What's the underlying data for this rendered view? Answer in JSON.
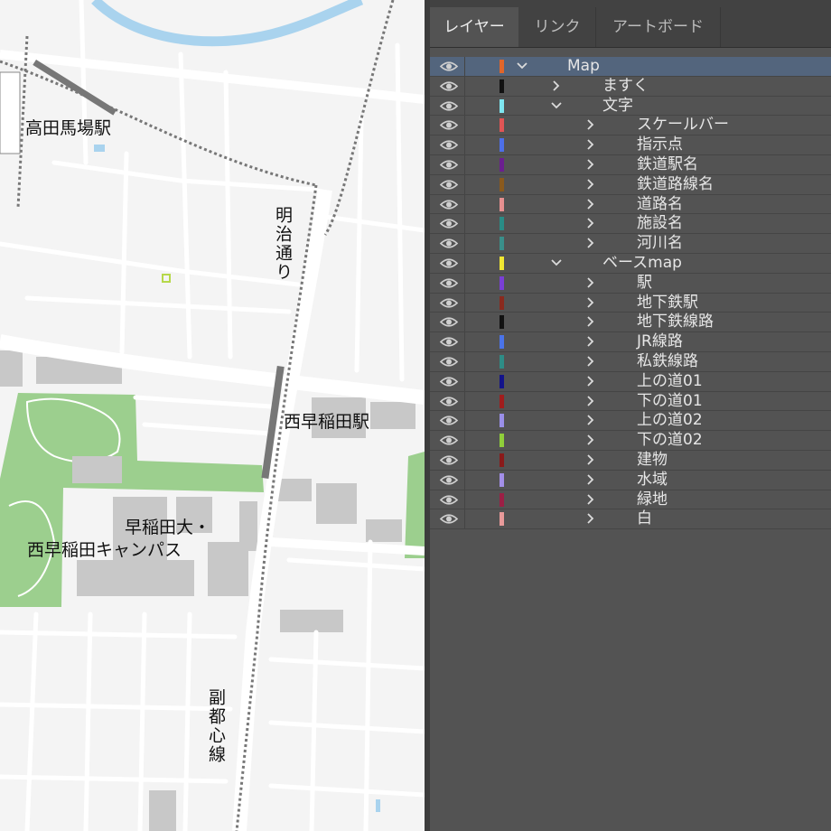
{
  "map": {
    "labels": {
      "takadanobaba": "高田馬場駅",
      "meiji_dori": "明治通り",
      "nishiwaseda_station": "西早稲田駅",
      "campus_line1": "早稲田大・",
      "campus_line2": "西早稲田キャンパス",
      "fukutoshin": "副都心線"
    },
    "colors": {
      "background": "#f4f4f4",
      "river": "#a9d3ee",
      "park": "#9ccf8e",
      "building": "#c8c8c8",
      "rail": "#777777"
    }
  },
  "panel": {
    "tabs": [
      {
        "label": "レイヤー",
        "active": true
      },
      {
        "label": "リンク",
        "active": false
      },
      {
        "label": "アートボード",
        "active": false
      }
    ],
    "layers": [
      {
        "name": "Map",
        "color": "#e0662a",
        "depth": 0,
        "expanded": true,
        "selected": true
      },
      {
        "name": "ますく",
        "color": "#111111",
        "depth": 1,
        "expanded": false
      },
      {
        "name": "文字",
        "color": "#7ee6f0",
        "depth": 1,
        "expanded": true
      },
      {
        "name": "スケールバー",
        "color": "#e05555",
        "depth": 2,
        "expanded": false
      },
      {
        "name": "指示点",
        "color": "#4d6fe8",
        "depth": 2,
        "expanded": false
      },
      {
        "name": "鉄道駅名",
        "color": "#6b1f8f",
        "depth": 2,
        "expanded": false
      },
      {
        "name": "鉄道路線名",
        "color": "#8a5a1e",
        "depth": 2,
        "expanded": false
      },
      {
        "name": "道路名",
        "color": "#e58f8f",
        "depth": 2,
        "expanded": false
      },
      {
        "name": "施設名",
        "color": "#2a8c86",
        "depth": 2,
        "expanded": false
      },
      {
        "name": "河川名",
        "color": "#3a8f8a",
        "depth": 2,
        "expanded": false
      },
      {
        "name": "ベースmap",
        "color": "#f0e632",
        "depth": 1,
        "expanded": true
      },
      {
        "name": "駅",
        "color": "#7a3fd6",
        "depth": 2,
        "expanded": false
      },
      {
        "name": "地下鉄駅",
        "color": "#8a2a1e",
        "depth": 2,
        "expanded": false
      },
      {
        "name": "地下鉄線路",
        "color": "#111111",
        "depth": 2,
        "expanded": false
      },
      {
        "name": "JR線路",
        "color": "#4a73e8",
        "depth": 2,
        "expanded": false
      },
      {
        "name": "私鉄線路",
        "color": "#2e8c86",
        "depth": 2,
        "expanded": false
      },
      {
        "name": "上の道01",
        "color": "#13138a",
        "depth": 2,
        "expanded": false
      },
      {
        "name": "下の道01",
        "color": "#a11d1d",
        "depth": 2,
        "expanded": false
      },
      {
        "name": "上の道02",
        "color": "#9a8fe8",
        "depth": 2,
        "expanded": false
      },
      {
        "name": "下の道02",
        "color": "#8fce3a",
        "depth": 2,
        "expanded": false
      },
      {
        "name": "建物",
        "color": "#8a1a1a",
        "depth": 2,
        "expanded": false
      },
      {
        "name": "水域",
        "color": "#a38fe8",
        "depth": 2,
        "expanded": false
      },
      {
        "name": "緑地",
        "color": "#9c1f45",
        "depth": 2,
        "expanded": false
      },
      {
        "name": "白",
        "color": "#e89a9a",
        "depth": 2,
        "expanded": false
      }
    ]
  }
}
